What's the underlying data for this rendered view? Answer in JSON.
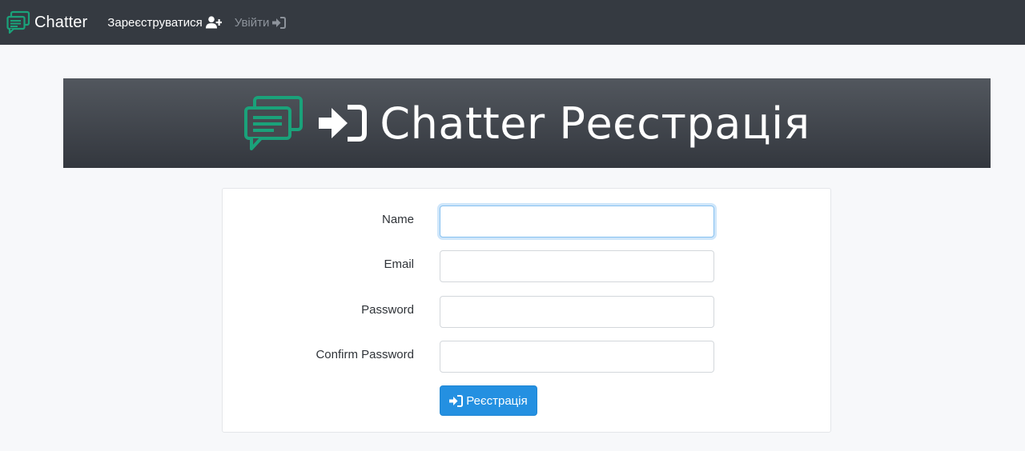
{
  "navbar": {
    "brand": "Chatter",
    "register_label": "Зареєструватися",
    "login_label": "Увійти",
    "icons": {
      "brand": "chat-bubbles-icon",
      "register": "user-plus-icon",
      "login": "sign-in-icon"
    }
  },
  "hero": {
    "title": "Chatter Реєстрація",
    "icons": [
      "chat-bubbles-icon",
      "sign-in-icon"
    ]
  },
  "form": {
    "fields": [
      {
        "label": "Name",
        "value": ""
      },
      {
        "label": "Email",
        "value": ""
      },
      {
        "label": "Password",
        "value": ""
      },
      {
        "label": "Confirm Password",
        "value": ""
      }
    ],
    "submit_label": "Реєстрація"
  },
  "colors": {
    "navbar_bg": "#353a41",
    "brand_green": "#1aa27a",
    "primary_button": "#2490e1",
    "page_bg": "#f7f8fa"
  }
}
